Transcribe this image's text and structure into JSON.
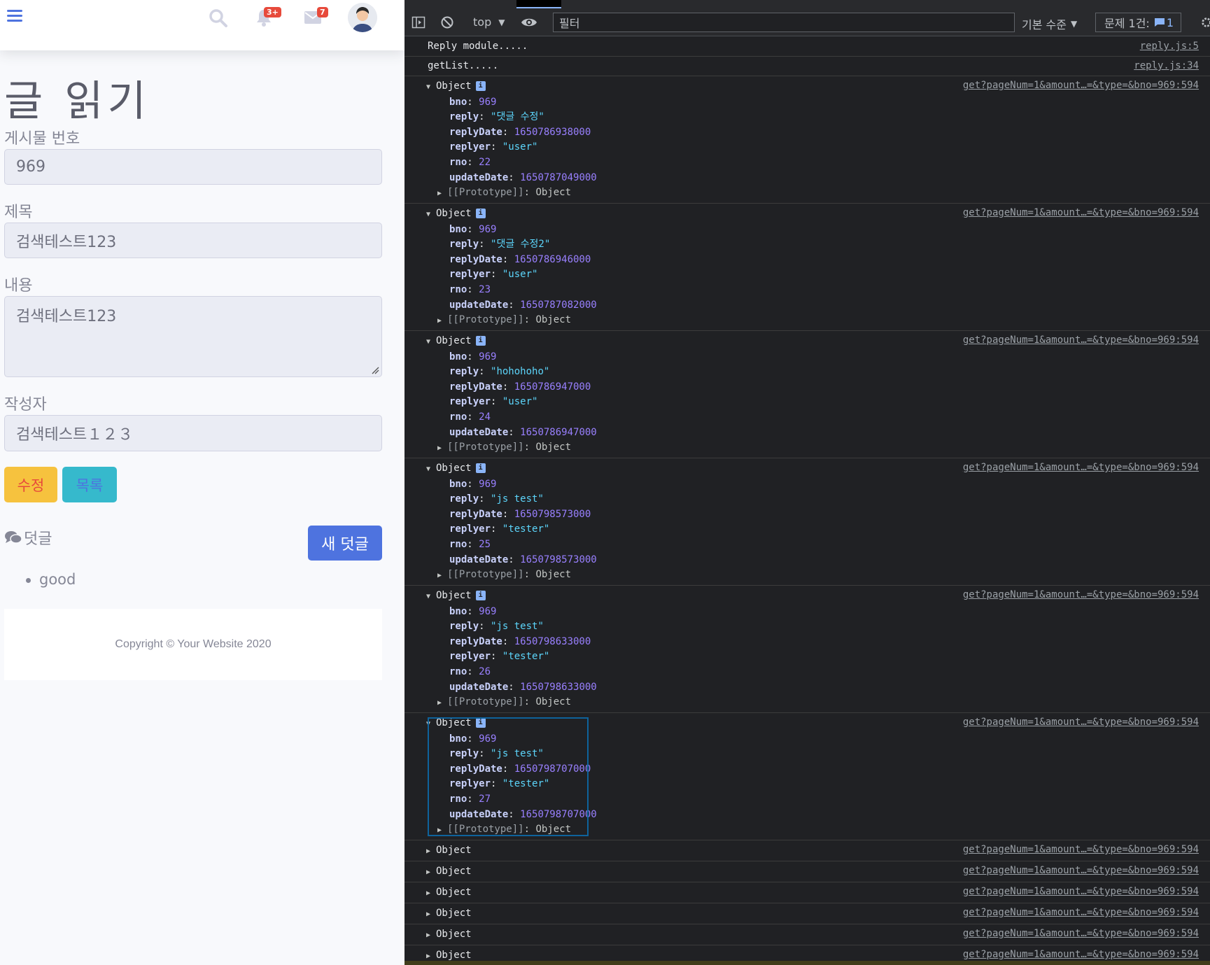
{
  "topbar": {
    "bell_badge": "3+",
    "mail_badge": "7",
    "icons": [
      "hamburger-icon",
      "search-icon",
      "bell-icon",
      "envelope-icon",
      "user-avatar"
    ]
  },
  "page": {
    "title": "글 읽기",
    "bno_label": "게시물 번호",
    "bno_value": "969",
    "title_label": "제목",
    "title_value": "검색테스트123",
    "content_label": "내용",
    "content_value": "검색테스트123",
    "writer_label": "작성자",
    "writer_value": "검색테스트１２３",
    "edit_button": "수정",
    "list_button": "목록",
    "reply_heading": "덧글",
    "new_reply_button": "새 덧글",
    "replies": [
      "good"
    ],
    "footer": "Copyright © Your Website 2020"
  },
  "devtools": {
    "context": "top",
    "filter_placeholder": "필터",
    "level": "기본 수준",
    "issues_label": "문제 1건:",
    "issues_count": "1",
    "colors": {
      "bg": "#202124",
      "key": "#c9d1fb",
      "number": "#9980ff",
      "string": "#5cd5fb",
      "link": "#9aa0a6"
    },
    "logs": [
      {
        "text": "Reply module.....",
        "source": "reply.js:5"
      },
      {
        "text": "getList.....",
        "source": "reply.js:34"
      }
    ],
    "object_source": "get?pageNum=1&amount…=&type=&bno=969:594",
    "objects": [
      {
        "bno": "969",
        "reply": "\"댓글 수정\"",
        "replyDate": "1650786938000",
        "replyer": "\"user\"",
        "rno": "22",
        "updateDate": "1650787049000"
      },
      {
        "bno": "969",
        "reply": "\"댓글 수정2\"",
        "replyDate": "1650786946000",
        "replyer": "\"user\"",
        "rno": "23",
        "updateDate": "1650787082000"
      },
      {
        "bno": "969",
        "reply": "\"hohohoho\"",
        "replyDate": "1650786947000",
        "replyer": "\"user\"",
        "rno": "24",
        "updateDate": "1650786947000"
      },
      {
        "bno": "969",
        "reply": "\"js test\"",
        "replyDate": "1650798573000",
        "replyer": "\"tester\"",
        "rno": "25",
        "updateDate": "1650798573000"
      },
      {
        "bno": "969",
        "reply": "\"js test\"",
        "replyDate": "1650798633000",
        "replyer": "\"tester\"",
        "rno": "26",
        "updateDate": "1650798633000"
      },
      {
        "bno": "969",
        "reply": "\"js test\"",
        "replyDate": "1650798707000",
        "replyer": "\"tester\"",
        "rno": "27",
        "updateDate": "1650798707000"
      }
    ],
    "selected_object_index": 5,
    "collapsed_label": "Object",
    "collapsed_count": 6,
    "proto_label": "[[Prototype]]",
    "proto_value": "Object"
  }
}
